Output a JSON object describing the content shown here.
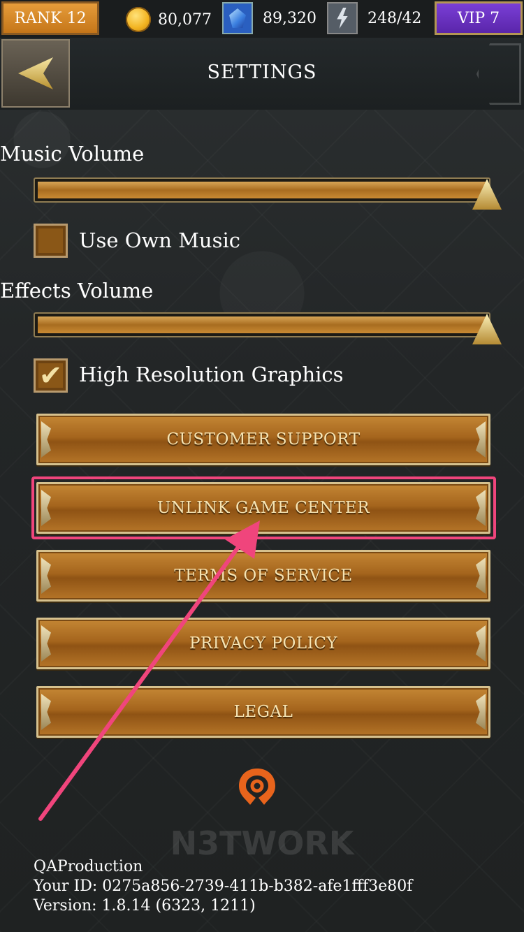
{
  "top_bar": {
    "rank": "RANK 12",
    "coins": "80,077",
    "gems": "89,320",
    "energy": "248/42",
    "vip": "VIP 7"
  },
  "header": {
    "title": "SETTINGS"
  },
  "settings": {
    "music_volume_label": "Music Volume",
    "music_volume_level": 1.0,
    "use_own_music_label": "Use Own Music",
    "use_own_music_checked": false,
    "effects_volume_label": "Effects Volume",
    "effects_volume_level": 1.0,
    "high_res_label": "High Resolution Graphics",
    "high_res_checked": true
  },
  "buttons": {
    "customer_support": "CUSTOMER SUPPORT",
    "unlink_game_center": "UNLINK GAME CENTER",
    "terms_of_service": "TERMS OF SERVICE",
    "privacy_policy": "PRIVACY POLICY",
    "legal": "LEGAL"
  },
  "branding": {
    "watermark": "N3TWORK"
  },
  "footer": {
    "environment": "QAProduction",
    "user_id": "Your ID: 0275a856-2739-411b-b382-afe1fff3e80f",
    "version": "Version: 1.8.14 (6323, 1211)"
  },
  "colors": {
    "highlight": "#f0457c",
    "button_gold": "#a5651d",
    "vip_purple": "#6a32c0",
    "rank_orange": "#d88a2a"
  }
}
